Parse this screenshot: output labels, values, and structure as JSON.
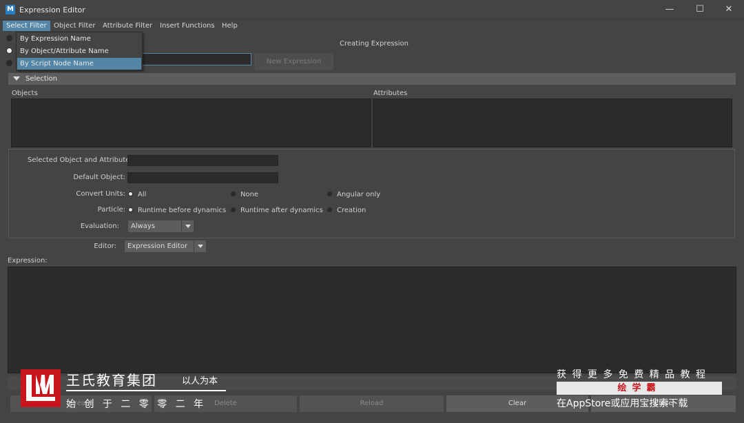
{
  "window": {
    "title": "Expression Editor",
    "minimize": "—",
    "maximize": "☐",
    "close": "✕"
  },
  "menubar": {
    "items": [
      "Select Filter",
      "Object Filter",
      "Attribute Filter",
      "Insert Functions",
      "Help"
    ]
  },
  "dropdown": {
    "items": [
      "By Expression Name",
      "By Object/Attribute Name",
      "By Script Node Name"
    ],
    "selected_index": 1,
    "highlighted_index": 2
  },
  "header": {
    "creating_label": "Creating Expression",
    "new_expression_label": "New Expression"
  },
  "selection": {
    "section_label": "Selection",
    "objects_label": "Objects",
    "attributes_label": "Attributes"
  },
  "form": {
    "selected_object_label": "Selected Object and Attribute:",
    "default_object_label": "Default Object:",
    "convert_units_label": "Convert Units:",
    "convert_units_options": [
      "All",
      "None",
      "Angular only"
    ],
    "convert_units_selected": 0,
    "particle_label": "Particle:",
    "particle_options": [
      "Runtime before dynamics",
      "Runtime after dynamics",
      "Creation"
    ],
    "particle_selected": 0,
    "evaluation_label": "Evaluation:",
    "evaluation_value": "Always",
    "editor_label": "Editor:",
    "editor_value": "Expression Editor",
    "expression_label": "Expression:"
  },
  "buttons": {
    "create": "Create",
    "delete": "Delete",
    "reload": "Reload",
    "clear": "Clear",
    "close": "Close"
  },
  "watermark": {
    "org_name": "王氏教育集团",
    "slogan": "以人为本",
    "founded": "始 创 于 二 零 零 二 年",
    "promo_line1": "获 得 更 多 免 费 精 品 教 程",
    "promo_brand": "绘学霸",
    "promo_line3": "在AppStore或应用宝搜索下载",
    "brand_color": "#c8161d"
  }
}
